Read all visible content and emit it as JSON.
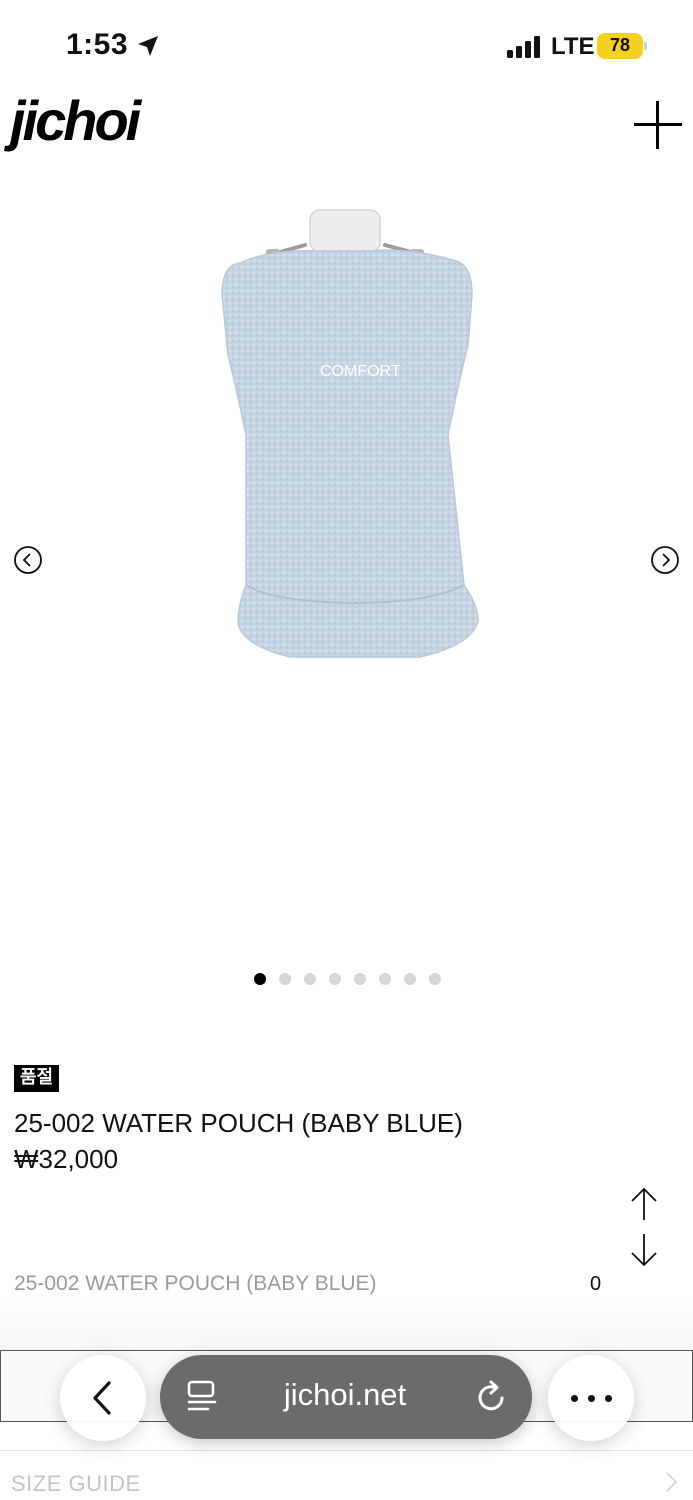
{
  "status_bar": {
    "time": "1:53",
    "network": "LTE",
    "battery": "78"
  },
  "header": {
    "logo": "jichoi"
  },
  "product_image": {
    "embroidery_text": "COMFORT",
    "pouch_color": "#c7d5e4"
  },
  "carousel": {
    "total_slides": 8,
    "active_index": 0
  },
  "product": {
    "badge": "품절",
    "title": "25-002 WATER POUCH (BABY BLUE)",
    "price": "₩32,000"
  },
  "option": {
    "name": "25-002 WATER POUCH (BABY BLUE)",
    "quantity": "0"
  },
  "size_guide": {
    "label": "SIZE GUIDE"
  },
  "browser": {
    "url": "jichoi.net"
  },
  "colors": {
    "accent": "#000000",
    "battery": "#f2d21f",
    "muted_text": "#9a9a9a",
    "address_bar": "#6b6b6b"
  }
}
